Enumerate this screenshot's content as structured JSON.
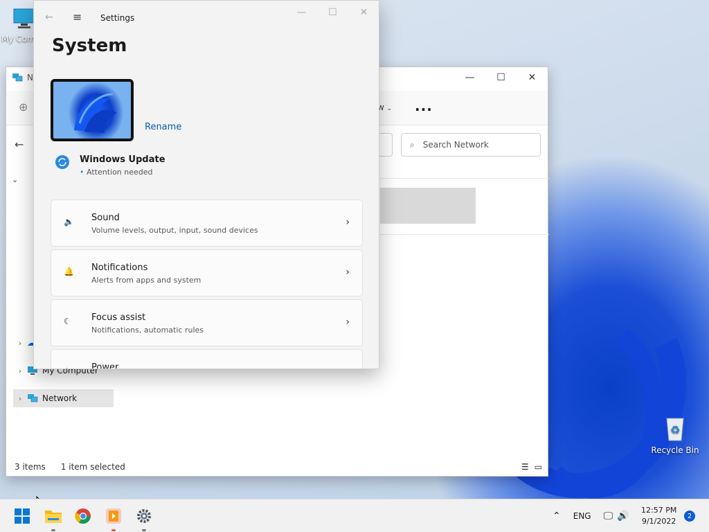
{
  "desktop": {
    "icons": [
      {
        "label": "My Comp"
      },
      {
        "label": "Recycle Bin"
      }
    ]
  },
  "explorer": {
    "title_fragment": "Ne",
    "toolbar_view_fragment": "w",
    "more_label": "...",
    "search_placeholder": "Search Network",
    "tree": [
      {
        "label": "My Computer"
      },
      {
        "label": "Network"
      }
    ],
    "status": {
      "items": "3 items",
      "selected": "1 item selected"
    }
  },
  "settings": {
    "app_title": "Settings",
    "page_heading": "System",
    "rename_label": "Rename",
    "update": {
      "title": "Windows Update",
      "subtitle": "Attention needed"
    },
    "cards": [
      {
        "title": "Sound",
        "subtitle": "Volume levels, output, input, sound devices",
        "icon": "speaker-icon"
      },
      {
        "title": "Notifications",
        "subtitle": "Alerts from apps and system",
        "icon": "bell-icon"
      },
      {
        "title": "Focus assist",
        "subtitle": "Notifications, automatic rules",
        "icon": "moon-icon"
      },
      {
        "title": "Power",
        "subtitle": "",
        "icon": "power-icon"
      }
    ]
  },
  "taskbar": {
    "language": "ENG",
    "time": "12:57 PM",
    "date": "9/1/2022",
    "notification_count": "2"
  },
  "colors": {
    "accent": "#0a5cd6",
    "link": "#0a5cad",
    "wallpaper_blue": "#1244d8"
  }
}
